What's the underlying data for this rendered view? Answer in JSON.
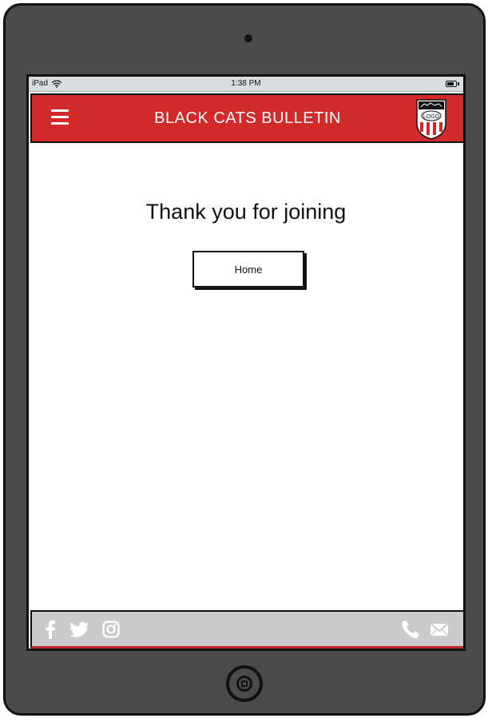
{
  "status_bar": {
    "device": "iPad",
    "time": "1:38 PM",
    "icons": [
      "wifi-icon",
      "battery-icon"
    ]
  },
  "header": {
    "title": "BLACK CATS BULLETIN",
    "menu_icon": "hamburger-menu-icon",
    "logo_text": "LOGO",
    "brand_color": "#d22a2a"
  },
  "main": {
    "message": "Thank you for joining",
    "home_button_label": "Home"
  },
  "footer": {
    "social_icons": [
      "facebook-icon",
      "twitter-icon",
      "instagram-icon"
    ],
    "contact_icons": [
      "phone-icon",
      "email-icon"
    ],
    "background_color": "#cbcbcb"
  }
}
